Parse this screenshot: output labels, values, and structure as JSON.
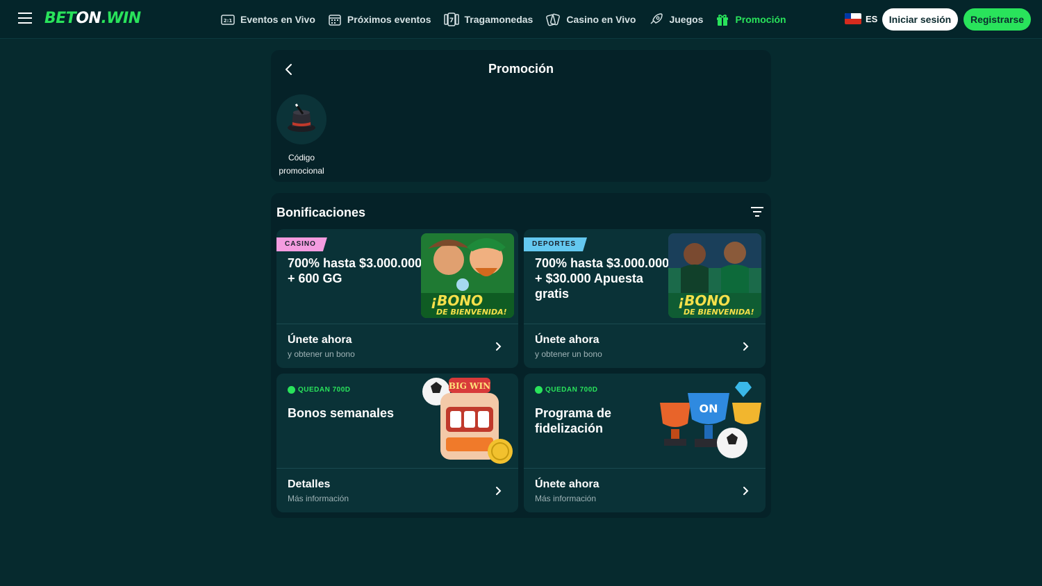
{
  "header": {
    "logo_left": "BET",
    "logo_on": "ON",
    "logo_right": ".WIN",
    "nav": [
      {
        "label": "Eventos en Vivo",
        "icon": "live-scoreboard-icon"
      },
      {
        "label": "Próximos eventos",
        "icon": "calendar-icon"
      },
      {
        "label": "Tragamonedas",
        "icon": "slot-seven-icon"
      },
      {
        "label": "Casino en Vivo",
        "icon": "playing-cards-icon"
      },
      {
        "label": "Juegos",
        "icon": "rocket-icon"
      },
      {
        "label": "Promoción",
        "icon": "gift-icon",
        "active": true
      }
    ],
    "lang": "ES",
    "login": "Iniciar sesión",
    "register": "Registrarse"
  },
  "promo": {
    "title": "Promoción",
    "tile_label": "Código promocional"
  },
  "bonuses": {
    "title": "Bonificaciones",
    "cards": [
      {
        "tag": "CASINO",
        "heading": "700% hasta $3.000.000 + 600 GG",
        "art_text_1": "¡BONO",
        "art_text_2": "DE BIENVENIDA!",
        "link": "Únete ahora",
        "sub": "y obtener un bono"
      },
      {
        "tag": "DEPORTES",
        "heading": "700% hasta $3.000.000 + $30.000 Apuesta gratis",
        "art_text_1": "¡BONO",
        "art_text_2": "DE BIENVENIDA!",
        "link": "Únete ahora",
        "sub": "y obtener un bono"
      },
      {
        "timer": "QUEDAN 700D",
        "heading": "Bonos semanales",
        "art_text_1": "BIG WIN",
        "link": "Detalles",
        "sub": "Más información"
      },
      {
        "timer": "QUEDAN 700D",
        "heading": "Programa de fidelización",
        "art_text_1": "ON",
        "link": "Únete ahora",
        "sub": "Más información"
      }
    ]
  },
  "colors": {
    "background": "#062a2e",
    "accent_green": "#29e35b",
    "casino_tag": "#f49ce0",
    "sport_tag": "#64c8f0"
  }
}
